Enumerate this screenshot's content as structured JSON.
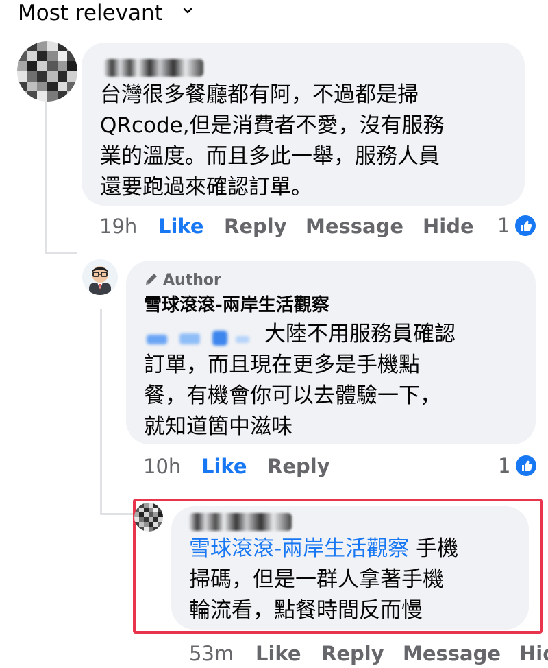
{
  "header": {
    "sort_label": "Most relevant",
    "sort_icon": "chevron-down-icon"
  },
  "colors": {
    "link_blue": "#1877f2",
    "bubble_gray": "#f0f2f5",
    "meta_gray": "#65676b",
    "highlight_red": "#e8344c"
  },
  "comments": [
    {
      "author": "J***y Lin",
      "text": "台灣很多餐廳都有阿，不過都是掃\nQRcode,但是消費者不愛，沒有服務\n業的溫度。而且多此一舉，服務人員\n還要跑過來確認訂單。",
      "time": "19h",
      "actions": [
        "Like",
        "Reply",
        "Message",
        "Hide"
      ],
      "reactions": "1"
    },
    {
      "badge": "Author",
      "author": "雪球滾滾-兩岸生活觀察",
      "text": "大陸不用服務員確認\n訂單，而且現在更多是手機點\n餐，有機會你可以去體驗一下，\n就知道箇中滋味",
      "time": "10h",
      "actions": [
        "Like",
        "Reply"
      ],
      "reactions": "1"
    },
    {
      "author": "J***y Lin",
      "mention": "雪球滾滾-兩岸生活觀察",
      "text_after_mention": " 手機",
      "text": "掃碼，但是一群人拿著手機\n輪流看，點餐時間反而慢",
      "time": "53m",
      "actions": [
        "Like",
        "Reply",
        "Message",
        "Hid"
      ]
    }
  ]
}
